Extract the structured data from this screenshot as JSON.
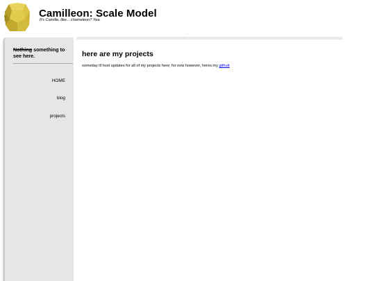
{
  "site": {
    "title": "Camilleon: Scale Model",
    "tagline": "It's Camille, like... chameleon? Yea."
  },
  "sidebar": {
    "note_struck": "Nothing",
    "note_rest": " something to see here.",
    "nav": [
      {
        "label": "HOME"
      },
      {
        "label": "blog"
      },
      {
        "label": "projects"
      }
    ]
  },
  "main": {
    "heading": "here are my projects",
    "paragraph": "someday ill host updates for all of my projects here; for now however, heres my ",
    "link_label": "github"
  },
  "colors": {
    "sidebar_bg": "#e6e6e6",
    "link": "#0000ee",
    "logo_yellow": "#d9c23a"
  },
  "icons": {
    "logo": "yellow-polyhedron-head-icon"
  }
}
